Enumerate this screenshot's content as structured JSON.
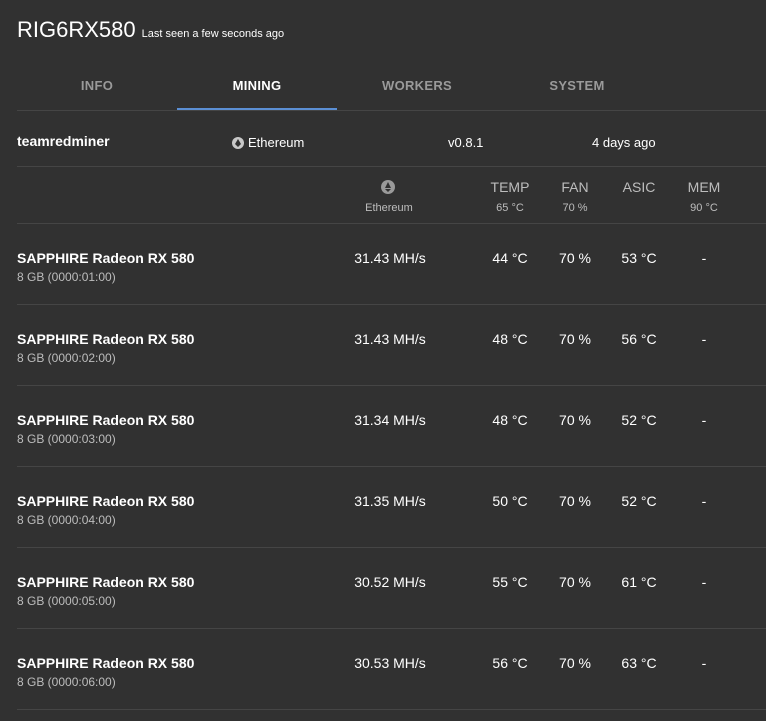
{
  "header": {
    "title": "RIG6RX580",
    "last_seen": "Last seen a few seconds ago"
  },
  "tabs": [
    {
      "label": "INFO",
      "active": false
    },
    {
      "label": "MINING",
      "active": true
    },
    {
      "label": "WORKERS",
      "active": false
    },
    {
      "label": "SYSTEM",
      "active": false
    }
  ],
  "miner": {
    "name": "teamredminer",
    "coin": "Ethereum",
    "version": "v0.8.1",
    "started": "4 days ago"
  },
  "columns": {
    "coin_label": "Ethereum",
    "temp": {
      "label": "TEMP",
      "limit": "65 °C"
    },
    "fan": {
      "label": "FAN",
      "limit": "70 %"
    },
    "asic": {
      "label": "ASIC",
      "limit": ""
    },
    "mem": {
      "label": "MEM",
      "limit": "90 °C"
    }
  },
  "gpus": [
    {
      "name": "SAPPHIRE Radeon RX 580",
      "memory": "8 GB (0000:01:00)",
      "hashrate": "31.43 MH/s",
      "temp": "44 °C",
      "fan": "70 %",
      "asic": "53 °C",
      "mem": "-"
    },
    {
      "name": "SAPPHIRE Radeon RX 580",
      "memory": "8 GB (0000:02:00)",
      "hashrate": "31.43 MH/s",
      "temp": "48 °C",
      "fan": "70 %",
      "asic": "56 °C",
      "mem": "-"
    },
    {
      "name": "SAPPHIRE Radeon RX 580",
      "memory": "8 GB (0000:03:00)",
      "hashrate": "31.34 MH/s",
      "temp": "48 °C",
      "fan": "70 %",
      "asic": "52 °C",
      "mem": "-"
    },
    {
      "name": "SAPPHIRE Radeon RX 580",
      "memory": "8 GB (0000:04:00)",
      "hashrate": "31.35 MH/s",
      "temp": "50 °C",
      "fan": "70 %",
      "asic": "52 °C",
      "mem": "-"
    },
    {
      "name": "SAPPHIRE Radeon RX 580",
      "memory": "8 GB (0000:05:00)",
      "hashrate": "30.52 MH/s",
      "temp": "55 °C",
      "fan": "70 %",
      "asic": "61 °C",
      "mem": "-"
    },
    {
      "name": "SAPPHIRE Radeon RX 580",
      "memory": "8 GB (0000:06:00)",
      "hashrate": "30.53 MH/s",
      "temp": "56 °C",
      "fan": "70 %",
      "asic": "63 °C",
      "mem": "-"
    }
  ],
  "colors": {
    "background": "#313131",
    "divider": "#454545",
    "tab_accent": "#5b8fd4",
    "muted_text": "#bdbdbd"
  }
}
